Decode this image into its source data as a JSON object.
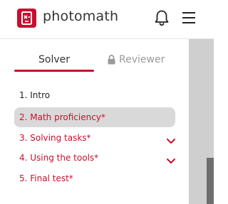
{
  "header": {
    "brand": "photomath",
    "logo_icon": "photomath-logo-icon",
    "notification_icon": "bell-icon",
    "menu_icon": "hamburger-menu-icon"
  },
  "tabs": [
    {
      "label": "Solver",
      "active": true
    },
    {
      "label": "Reviewer",
      "active": false,
      "locked": true,
      "icon": "lock-icon"
    }
  ],
  "outline": {
    "items": [
      {
        "label": "1. Intro",
        "state": "completed"
      },
      {
        "label": "2. Math proficiency*",
        "state": "selected"
      },
      {
        "label": "3. Solving tasks*",
        "state": "pending",
        "expandable": true
      },
      {
        "label": "4. Using the tools*",
        "state": "pending",
        "expandable": true
      },
      {
        "label": "5. Final test*",
        "state": "pending"
      }
    ]
  },
  "colors": {
    "accent": "#c8102e",
    "selected_bg": "#d9d9d9",
    "muted_text": "#9a9a9a",
    "scroll_track": "#cfcfcf",
    "scroll_thumb": "#6e6e6e"
  }
}
